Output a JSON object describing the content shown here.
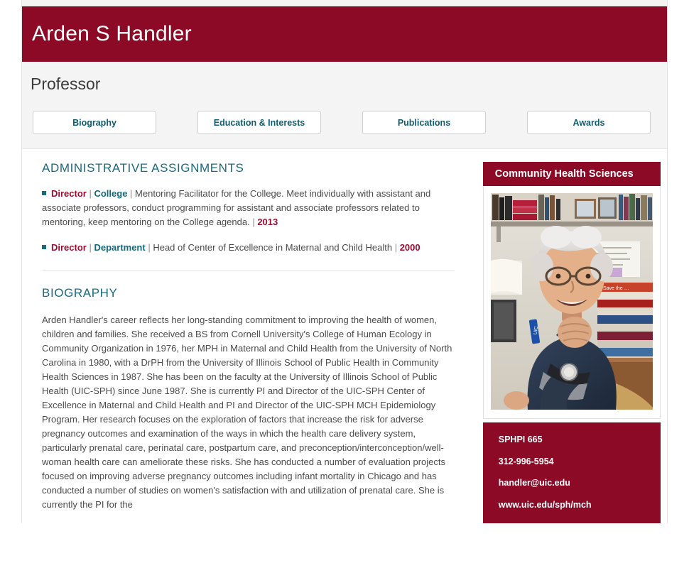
{
  "header": {
    "full_name": "Arden S Handler",
    "banner_color": "#8d0a26"
  },
  "profile": {
    "title": "Professor"
  },
  "tabs": [
    {
      "label": "Biography",
      "name": "tab-biography"
    },
    {
      "label": "Education & Interests",
      "name": "tab-education-interests"
    },
    {
      "label": "Publications",
      "name": "tab-publications"
    },
    {
      "label": "Awards",
      "name": "tab-awards"
    }
  ],
  "sections": {
    "administrative_heading": "ADMINISTRATIVE ASSIGNMENTS",
    "biography_heading": "BIOGRAPHY"
  },
  "assignments": [
    {
      "role": "Director",
      "scope": "College",
      "description": "Mentoring Facilitator for the College. Meet individually with assistant and associate professors, conduct programming for assistant and associate professors related to mentoring, keep mentoring on the College agenda.",
      "year": "2013"
    },
    {
      "role": "Director",
      "scope": "Department",
      "description": "Head of Center of Excellence in Maternal and Child Health",
      "year": "2000"
    }
  ],
  "biography": {
    "text": "Arden Handler's career reflects her long-standing commitment to improving the health of women, children and families. She received a BS from Cornell University's College of Human Ecology in Community Organization in 1976, her MPH in Maternal and Child Health from the University of North Carolina in 1980, with a DrPH from the University of Illinois School of Public Health in Community Health Sciences in 1987. She has been on the faculty at the University of Illinois School of Public Health (UIC-SPH) since June 1987. She is currently PI and Director of the UIC-SPH Center of Excellence in Maternal and Child Health and PI and Director of the UIC-SPH MCH Epidemiology Program. Her research focuses on the exploration of factors that increase the risk for adverse pregnancy outcomes and examination of the ways in which the health care delivery system, particularly prenatal care, perinatal care, postpartum care, and preconception/interconception/well-woman health care can ameliorate these risks. She has conducted a number of evaluation projects focused on improving adverse pregnancy outcomes including infant mortality in Chicago and has conducted a number of studies on women's satisfaction with and utilization of prenatal care. She is currently the PI for the"
  },
  "sidebar": {
    "department": "Community Health Sciences",
    "photo_alt": "Portrait of Arden S Handler seated in an office in front of bookshelves",
    "contact": {
      "office": "SPHPI 665",
      "phone": "312-996-5954",
      "email": "handler@uic.edu",
      "website": "www.uic.edu/sph/mch"
    }
  },
  "colors": {
    "maroon": "#8d0a26",
    "teal": "#1a6a7d",
    "crimson_text": "#9c0d32",
    "body_text": "#4b4b4b",
    "strip_bg": "#f4f4f4"
  }
}
